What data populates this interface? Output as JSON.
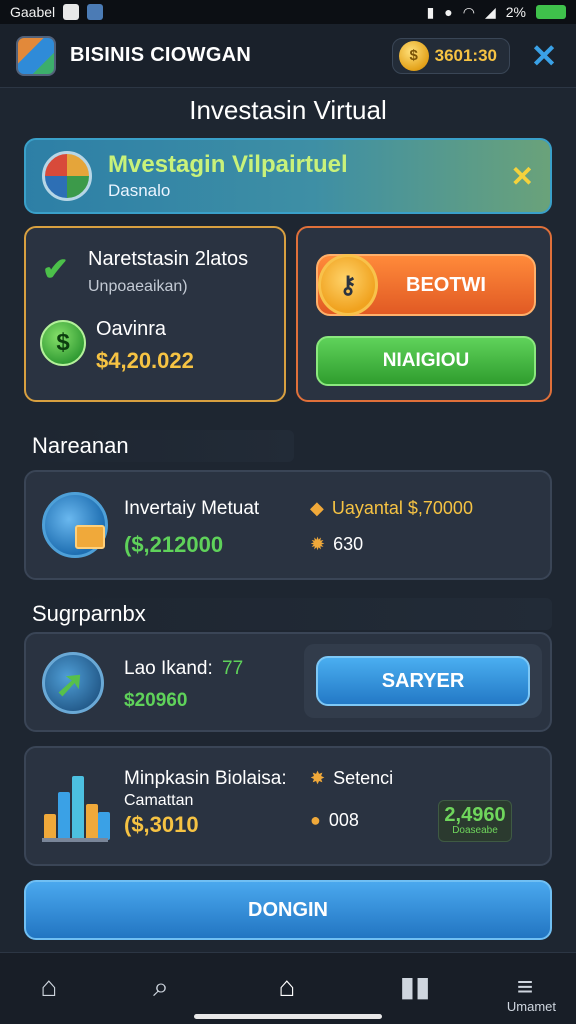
{
  "status_bar": {
    "carrier": "Gaabel",
    "battery": "2%"
  },
  "header": {
    "app_title": "BISINIS CIOWGAN",
    "coin_value": "3601:30",
    "close_glyph": "✕"
  },
  "page_title": "Investasin Virtual",
  "banner": {
    "title": "Mvestagin Vilpairtuel",
    "subtitle": "Dasnalo",
    "close_glyph": "✕"
  },
  "card_left": {
    "title": "Naretstasin 2latos",
    "subtitle": "Unpoaeaikan)",
    "label": "Oavinra",
    "amount": "$4,20.022"
  },
  "card_right": {
    "orange_button": "BEOTWI",
    "green_button": "NIAIGIOU"
  },
  "section1": {
    "title": "Nareanan"
  },
  "item1": {
    "title": "Invertaiy Metuat",
    "green_value": "($,212000",
    "meta1": "Uayantal $,70000",
    "meta2": "630"
  },
  "section2": {
    "title": "Sugrparnbx"
  },
  "item2": {
    "title": "Lao Ikand:",
    "title_num": "77",
    "green_value": "$20960",
    "button": "SARYER"
  },
  "item3": {
    "title": "Minpkasin Biolaisa:",
    "subtitle": "Camattan",
    "amount": "($,3010",
    "meta1": "Setenci",
    "meta2": "008",
    "badge_value": "2,4960",
    "badge_sub": "Doaseabe"
  },
  "bottom_button": "DONGIN",
  "nav": {
    "label": "Umamet"
  },
  "colors": {
    "background": "#1e2631",
    "card": "#2a3341",
    "accent_blue": "#3aa1e6",
    "accent_green": "#5fd25a",
    "accent_gold": "#f6c343",
    "accent_orange": "#e15a24"
  },
  "icons": [
    "app-logo",
    "coin-icon",
    "close-icon",
    "chart-pie-icon",
    "check-icon",
    "dollar-icon",
    "key-icon",
    "globe-icon",
    "document-icon",
    "tag-icon",
    "gear-icon",
    "arrow-up-icon",
    "bar-chart-icon",
    "star-icon",
    "chat-icon",
    "home-icon",
    "search-icon",
    "house-icon",
    "book-icon",
    "menu-icon"
  ]
}
